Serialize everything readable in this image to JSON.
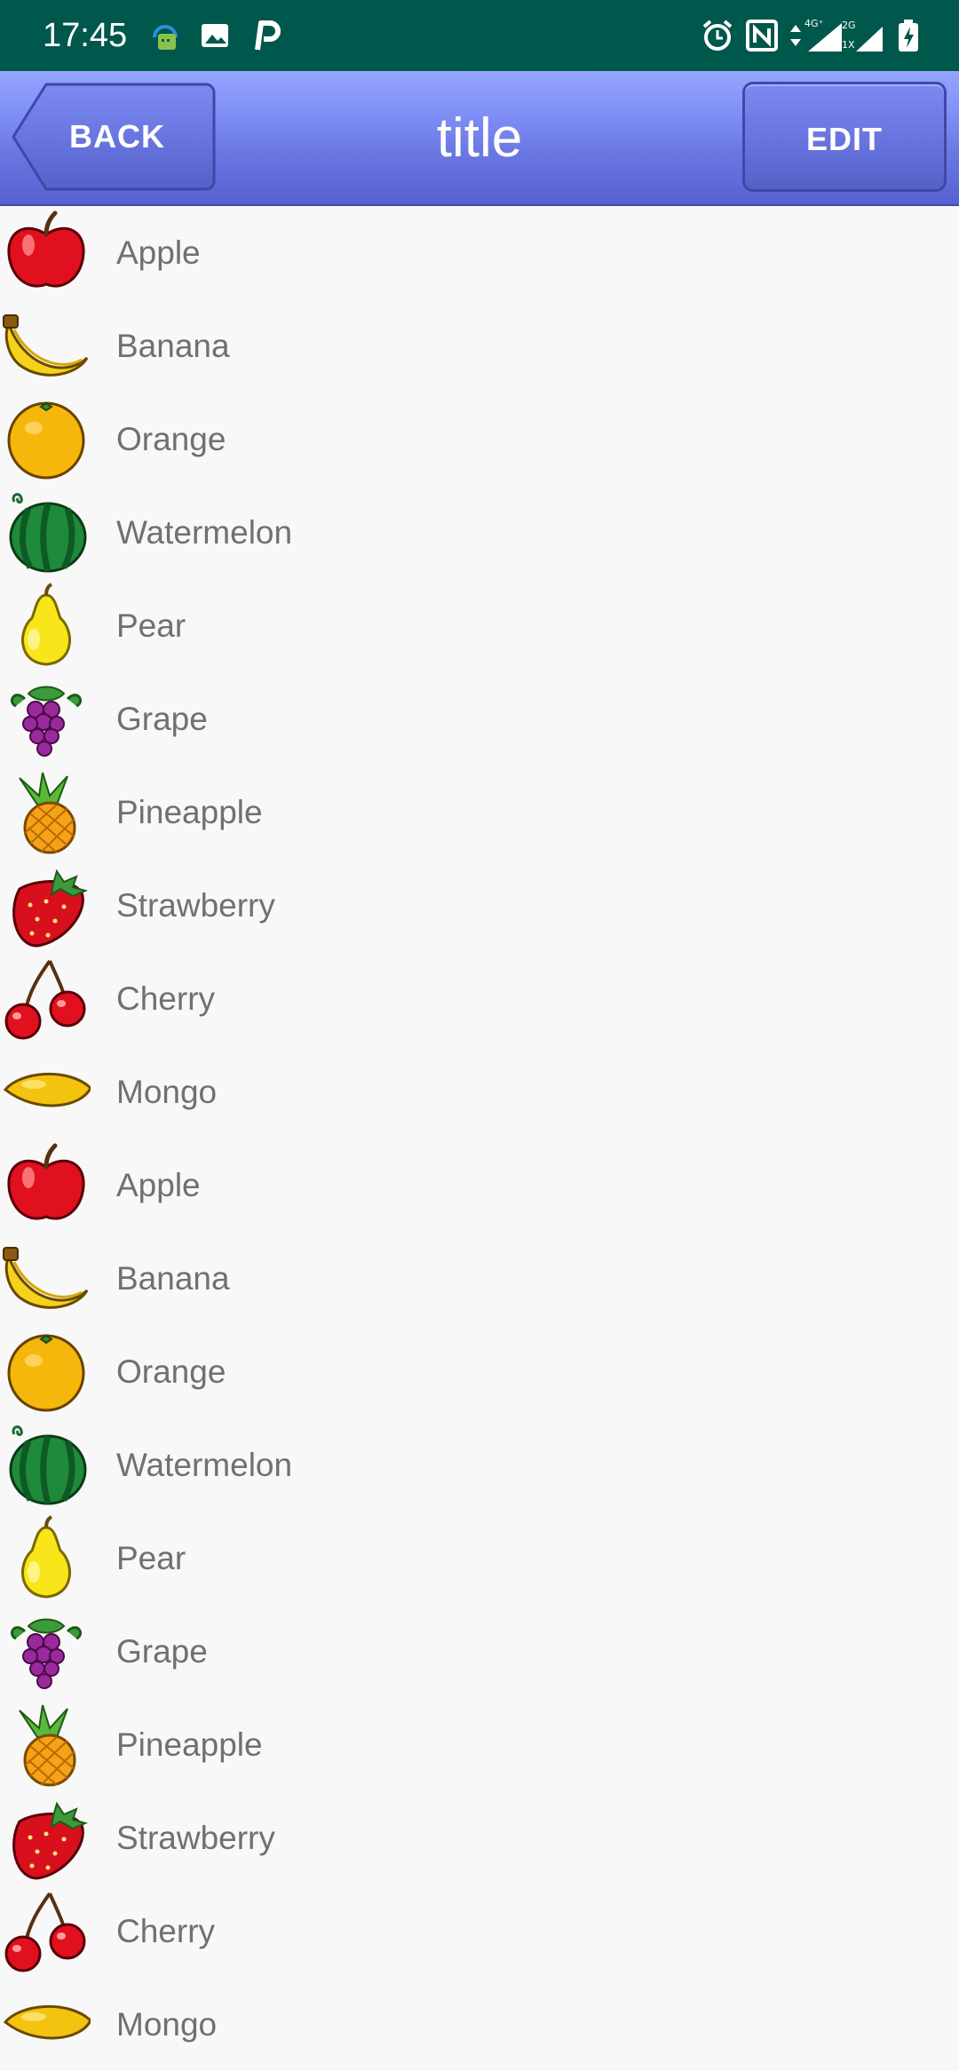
{
  "status_bar": {
    "time": "17:45",
    "left_icons": [
      "bug-notification-icon",
      "image-notification-icon",
      "parking-app-icon"
    ],
    "right_icons": [
      "alarm-icon",
      "nfc-icon",
      "data-arrows-icon",
      "signal-4g-icon",
      "signal-2g-icon",
      "battery-charging-icon"
    ],
    "background": "#00574b"
  },
  "app_bar": {
    "back_label": "BACK",
    "title": "title",
    "edit_label": "EDIT",
    "accent": "#6c78e2"
  },
  "list": {
    "items": [
      {
        "label": "Apple",
        "icon": "apple-icon"
      },
      {
        "label": "Banana",
        "icon": "banana-icon"
      },
      {
        "label": "Orange",
        "icon": "orange-icon"
      },
      {
        "label": "Watermelon",
        "icon": "watermelon-icon"
      },
      {
        "label": "Pear",
        "icon": "pear-icon"
      },
      {
        "label": "Grape",
        "icon": "grape-icon"
      },
      {
        "label": "Pineapple",
        "icon": "pineapple-icon"
      },
      {
        "label": "Strawberry",
        "icon": "strawberry-icon"
      },
      {
        "label": "Cherry",
        "icon": "cherry-icon"
      },
      {
        "label": "Mongo",
        "icon": "mango-icon"
      },
      {
        "label": "Apple",
        "icon": "apple-icon"
      },
      {
        "label": "Banana",
        "icon": "banana-icon"
      },
      {
        "label": "Orange",
        "icon": "orange-icon"
      },
      {
        "label": "Watermelon",
        "icon": "watermelon-icon"
      },
      {
        "label": "Pear",
        "icon": "pear-icon"
      },
      {
        "label": "Grape",
        "icon": "grape-icon"
      },
      {
        "label": "Pineapple",
        "icon": "pineapple-icon"
      },
      {
        "label": "Strawberry",
        "icon": "strawberry-icon"
      },
      {
        "label": "Cherry",
        "icon": "cherry-icon"
      },
      {
        "label": "Mongo",
        "icon": "mango-icon"
      }
    ]
  }
}
